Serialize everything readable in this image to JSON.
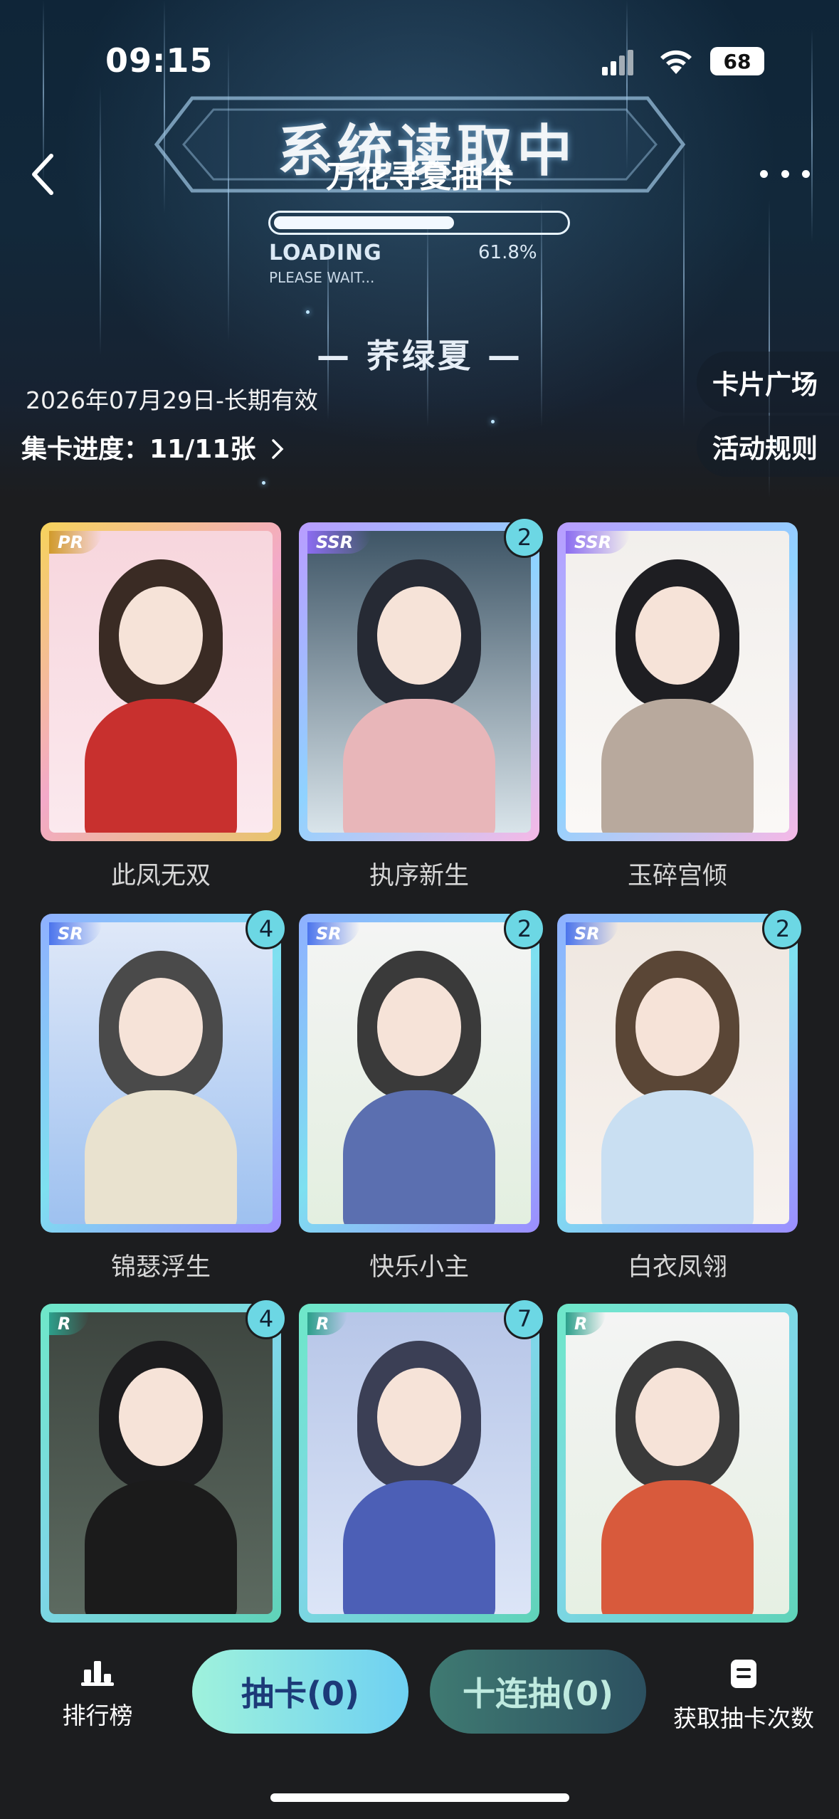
{
  "status": {
    "time": "09:15",
    "battery": "68"
  },
  "header": {
    "bg_title": "系统读取中",
    "title": "万花寻夏抽卡",
    "loading_label": "LOADING",
    "loading_percent": "61.8%",
    "loading_progress": 0.618,
    "loading_wait": "PLEASE WAIT...",
    "subtitle": "— 荞绿夏 —",
    "date": "2026年07月29日-长期有效",
    "progress": "集卡进度：11/11张",
    "card_square": "卡片广场",
    "rules": "活动规则"
  },
  "cards": [
    {
      "name": "此凤无双",
      "rarity": "PR",
      "count": ""
    },
    {
      "name": "执序新生",
      "rarity": "SSR",
      "count": "2"
    },
    {
      "name": "玉碎宫倾",
      "rarity": "SSR",
      "count": ""
    },
    {
      "name": "锦瑟浮生",
      "rarity": "SR",
      "count": "4"
    },
    {
      "name": "快乐小主",
      "rarity": "SR",
      "count": "2"
    },
    {
      "name": "白衣凤翎",
      "rarity": "SR",
      "count": "2"
    },
    {
      "name": "",
      "rarity": "R",
      "count": "4"
    },
    {
      "name": "",
      "rarity": "R",
      "count": "7"
    },
    {
      "name": "",
      "rarity": "R",
      "count": ""
    }
  ],
  "bottom": {
    "rank": "排行榜",
    "draw": "抽卡(0)",
    "draw10": "十连抽(0)",
    "get_chances": "获取抽卡次数"
  },
  "colors": {
    "accent": "#6cd7e4",
    "draw_btn": "#8ef0e0",
    "draw10_btn": "#3c6a6e"
  }
}
